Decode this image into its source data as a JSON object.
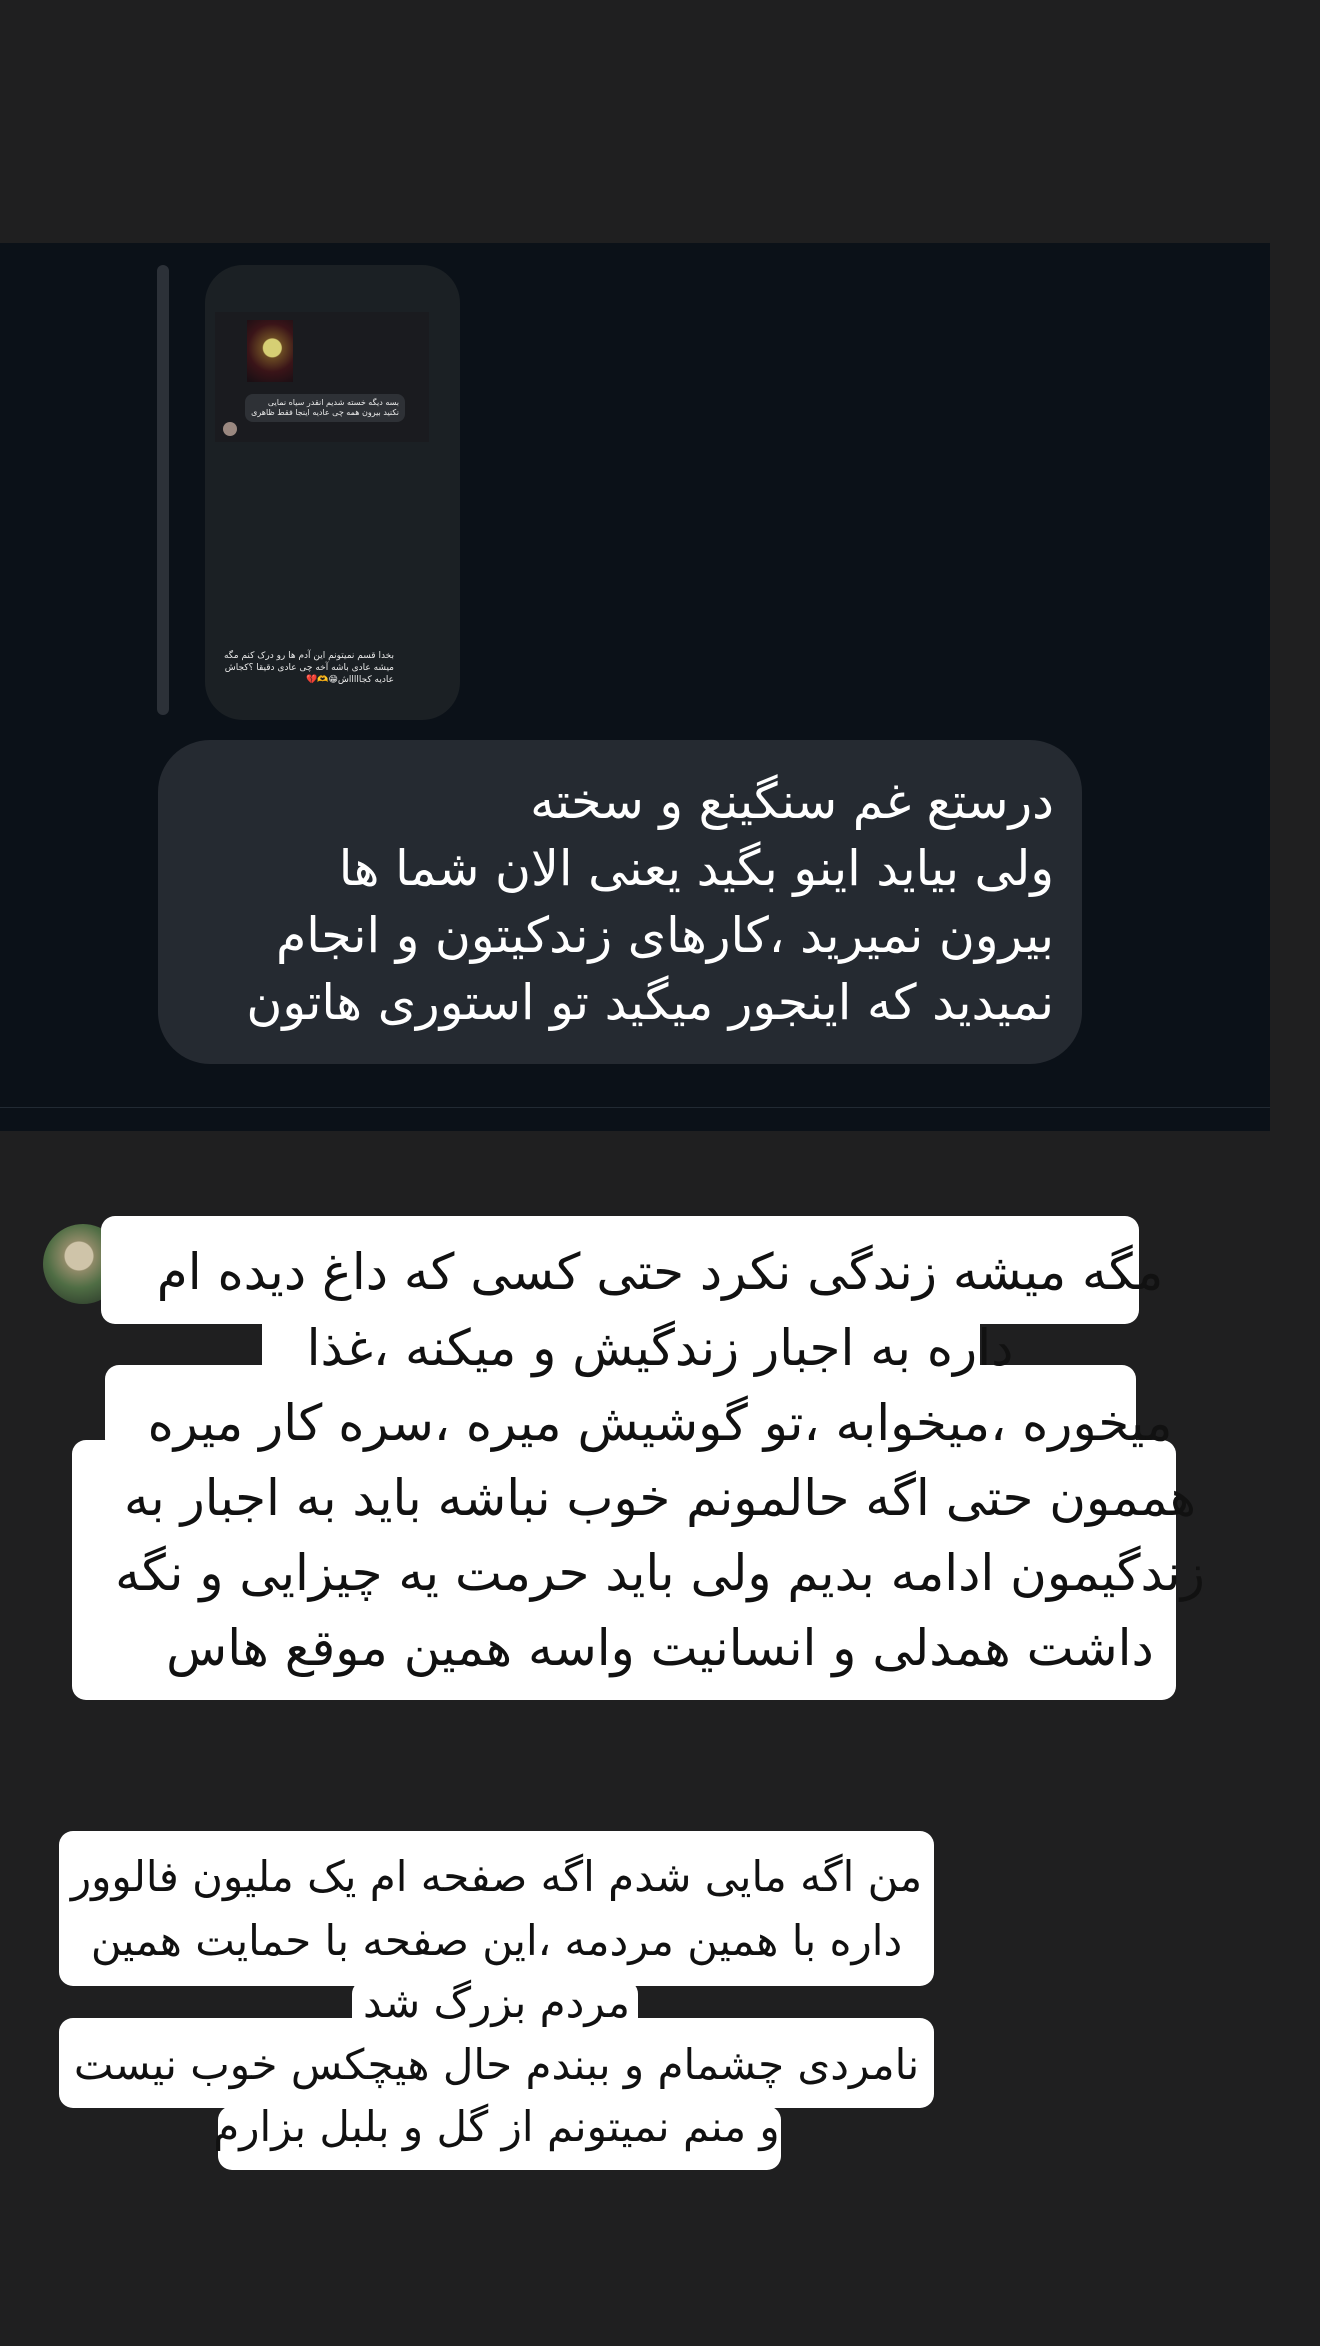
{
  "chat": {
    "story_caption": "بسه دیگه خسته شدیم انقدر سیاه نمایی نکنید بیرون همه چی عادیه اینجا فقط ظاهری",
    "story_bottom_text": "بخدا قسم نمیتونم این آدم ها رو درک کنم مگه میشه عادی باشه آخه چی عادی دقیقا ؟کجاش عادیه کجاااااش😁🫶💔",
    "reply_text": "درستع غم سنگینع و سخته\nولی بیاید اینو بگید یعنی الان شما ها\nبیرون نمیرید ،کارهای زندکیتون و انجام\nنمیدید که اینجور میگید تو استوری هاتون"
  },
  "text_block_1": {
    "lines": [
      "مگه میشه زندگی نکرد حتی کسی که داغ دیده ام",
      "داره به اجبار زندگیش و میکنه ،غذا",
      "میخوره ،میخوابه ،تو گوشیش میره ،سره کار میره",
      "هممون حتی اگه حالمونم خوب نباشه باید به اجبار به",
      "زندگیمون ادامه بدیم ولی باید حرمت یه چیزایی و نگه",
      "داشت همدلی و انسانیت واسه همین موقع هاس"
    ]
  },
  "text_block_2": {
    "lines": [
      "من اگه مایی شدم اگه صفحه ام یک ملیون فالوور",
      "داره با همین مردمه ،این صفحه با حمایت همین",
      "مردم بزرگ شد",
      "نامردی چشمام و ببندم حال هیچکس خوب نیست",
      "و منم نمیتونم از گل و بلبل بزارم"
    ]
  }
}
